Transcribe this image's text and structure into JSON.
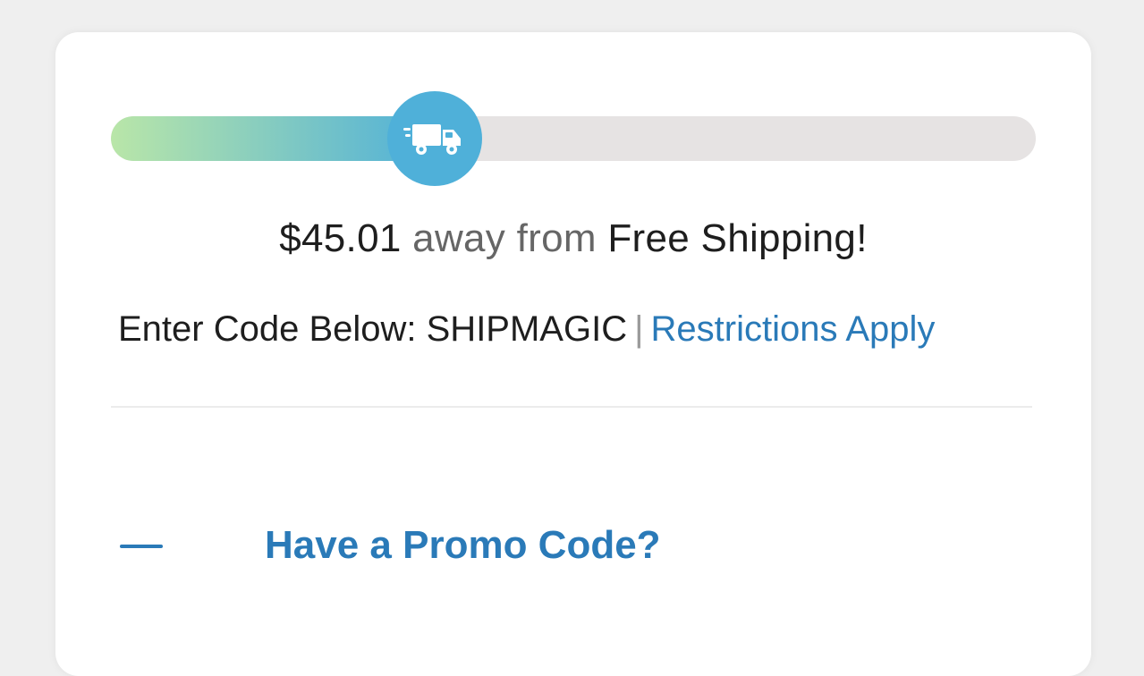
{
  "colors": {
    "accent": "#2a7ab8",
    "badge": "#4fb0d9",
    "fill_start": "#b9e6a8",
    "fill_end": "#4fb0d9"
  },
  "progress": {
    "fraction": 0.35,
    "icon": "truck-icon"
  },
  "shipping": {
    "amount": "$45.01",
    "away_text": "away from",
    "goal_text": "Free Shipping!"
  },
  "code": {
    "prefix": "Enter Code Below: SHIPMAGIC",
    "separator": "|",
    "link": "Restrictions Apply"
  },
  "promo": {
    "toggle_icon": "minus-icon",
    "label": "Have a Promo Code?"
  }
}
